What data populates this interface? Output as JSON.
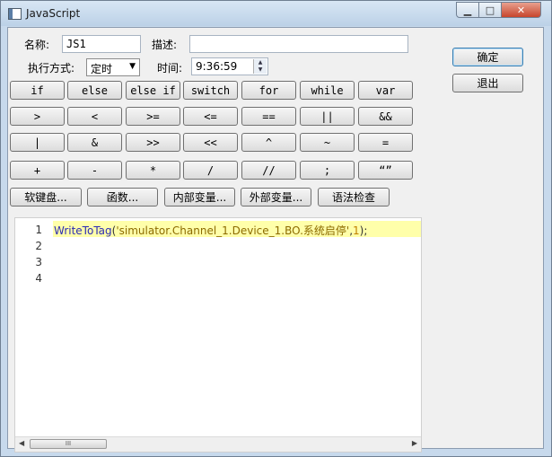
{
  "window": {
    "title": "JavaScript",
    "minimize": "▁",
    "maximize": "□",
    "close": "✕"
  },
  "form": {
    "name_label": "名称:",
    "name_value": "JS1",
    "desc_label": "描述:",
    "desc_value": "",
    "mode_label": "执行方式:",
    "mode_value": "定时",
    "time_label": "时间:",
    "time_value": "9:36:59"
  },
  "keywords": [
    [
      "if",
      "else",
      "else if",
      "switch",
      "for",
      "while",
      "var"
    ],
    [
      ">",
      "<",
      ">=",
      "<=",
      "==",
      "||",
      "&&"
    ],
    [
      "|",
      "&",
      ">>",
      "<<",
      "^",
      "~",
      "="
    ],
    [
      "+",
      "-",
      "*",
      "/",
      "//",
      ";",
      "“”"
    ]
  ],
  "tools": [
    "软键盘...",
    "函数...",
    "内部变量...",
    "外部变量...",
    "语法检查"
  ],
  "buttons": {
    "ok": "确定",
    "exit": "退出"
  },
  "editor": {
    "line_numbers": [
      "1",
      "2",
      "3",
      "4"
    ],
    "code_fn": "WriteToTag",
    "code_open": "(",
    "code_str": "'simulator.Channel_1.Device_1.BO.系统启停'",
    "code_comma": ",",
    "code_num": "1",
    "code_close": ");",
    "scroll_thumb": "III"
  }
}
